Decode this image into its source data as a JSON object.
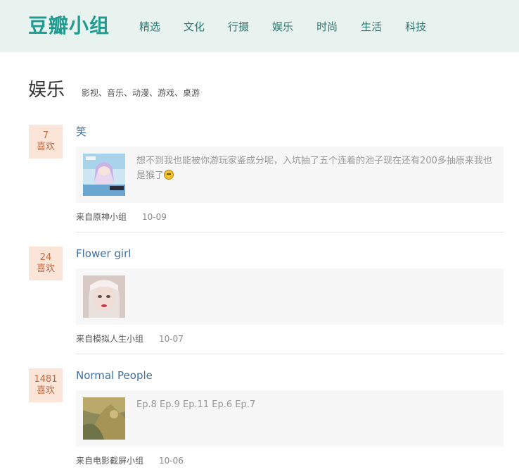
{
  "header": {
    "logo": "豆瓣小组",
    "nav": [
      "精选",
      "文化",
      "行摄",
      "娱乐",
      "时尚",
      "生活",
      "科技"
    ]
  },
  "category": {
    "title": "娱乐",
    "subtitle": "影视、音乐、动漫、游戏、桌游"
  },
  "posts": [
    {
      "likes_count": "7",
      "likes_label": "喜欢",
      "title": "笑",
      "excerpt": "想不到我也能被你游玩家鉴成分呢，入坑抽了五个连着的池子现在还有200多抽原来我也是猴了",
      "thumb_icon": "anime-character-image",
      "group": "来自原神小组",
      "date": "10-09"
    },
    {
      "likes_count": "24",
      "likes_label": "喜欢",
      "title": "Flower girl",
      "excerpt": "",
      "thumb_icon": "portrait-image",
      "group": "来自模拟人生小组",
      "date": "10-07"
    },
    {
      "likes_count": "1481",
      "likes_label": "喜欢",
      "title": "Normal People",
      "excerpt": "Ep.8 Ep.9 Ep.11 Ep.6 Ep.7",
      "thumb_icon": "film-still-image",
      "group": "来自电影截屏小组",
      "date": "10-06"
    }
  ]
}
